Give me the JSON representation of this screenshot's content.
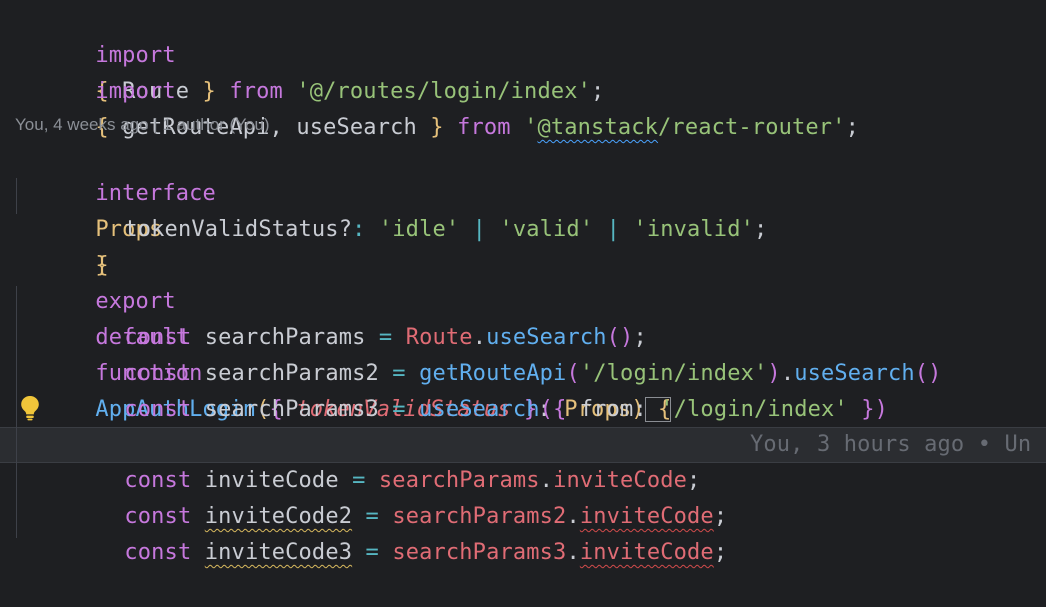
{
  "editor": {
    "lines": [
      {
        "id": "import-route",
        "tokens": [
          "import",
          "{ ",
          "Route",
          " }",
          " from",
          " '@/routes/login/index'",
          ";"
        ]
      },
      {
        "id": "import-router",
        "tokens": [
          "import",
          "{ ",
          "getRouteApi",
          ", ",
          "useSearch",
          " }",
          " from",
          " '",
          "@tanstack",
          "/react-router",
          "'",
          ";"
        ]
      },
      {
        "id": "interface-open",
        "tokens": [
          "interface",
          "Props",
          "{"
        ]
      },
      {
        "id": "token-prop",
        "tokens": [
          "tokenValidStatus?",
          ": ",
          "'idle'",
          " | ",
          "'valid'",
          " | ",
          "'invalid'",
          ";"
        ]
      },
      {
        "id": "interface-close",
        "tokens": [
          "}"
        ]
      },
      {
        "id": "function-signature",
        "tokens": [
          "export",
          "default",
          "function",
          "AppAuthLogin",
          "(",
          "{ ",
          "tokenValidStatus",
          " }",
          ": ",
          "Props",
          ")",
          " {"
        ]
      },
      {
        "id": "search-params",
        "tokens": [
          "const",
          "searchParams",
          " = ",
          "Route",
          ".",
          "useSearch",
          "()",
          ";"
        ]
      },
      {
        "id": "search-params-2",
        "tokens": [
          "const",
          "searchParams2",
          " = ",
          "getRouteApi",
          "(",
          "'/login/index'",
          ")",
          ".",
          "useSearch",
          "()"
        ]
      },
      {
        "id": "search-params-3",
        "tokens": [
          "const",
          "searchParams3",
          " = ",
          "useSearch",
          "(",
          "{ ",
          "from",
          ": ",
          "'/login/index'",
          " }",
          ")"
        ]
      },
      {
        "id": "invite-code",
        "tokens": [
          "const",
          "inviteCode",
          " = ",
          "searchParams",
          ".",
          "inviteCode",
          ";"
        ]
      },
      {
        "id": "invite-code-2",
        "tokens": [
          "const",
          "inviteCode2",
          " = ",
          "searchParams2",
          ".",
          "inviteCode",
          ";"
        ]
      },
      {
        "id": "invite-code-3",
        "tokens": [
          "const",
          "inviteCode3",
          " = ",
          "searchParams3",
          ".",
          "inviteCode",
          ";"
        ]
      }
    ],
    "codelens": "You, 4 weeks ago | 1 author (You)",
    "blame": "You, 3 hours ago • Un",
    "icons": {
      "lightbulb": "lightbulb-icon"
    },
    "colors": {
      "background": "#1e1f22",
      "keyword": "#c678dd",
      "type": "#e5c07b",
      "function": "#61afef",
      "string": "#98c379",
      "variable": "#e06c75"
    }
  }
}
